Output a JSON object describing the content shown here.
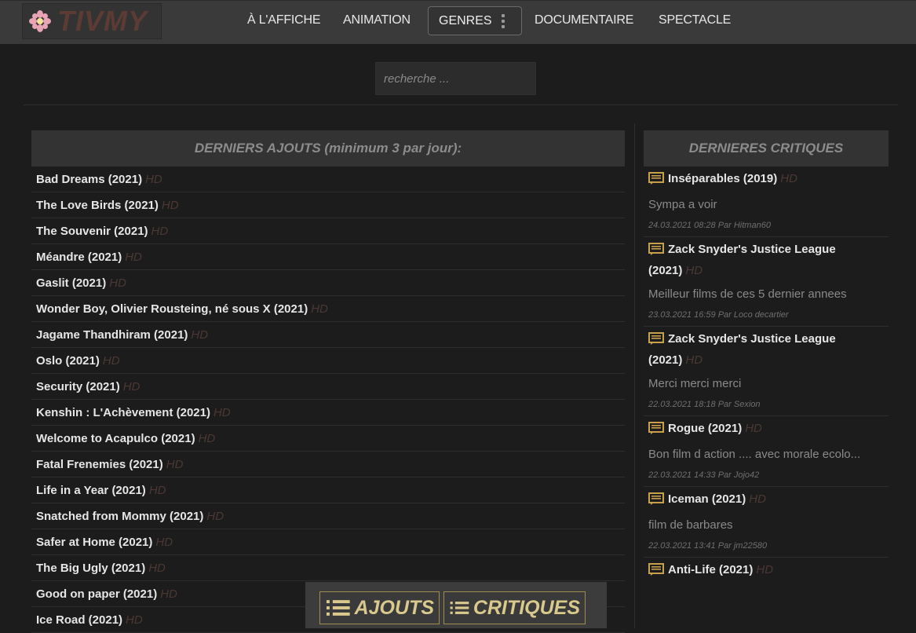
{
  "header": {
    "logo_text": "TIVMY",
    "nav": {
      "affiche": "À L'AFFICHE",
      "animation": "ANIMATION",
      "genres": "GENRES",
      "documentaire": "DOCUMENTAIRE",
      "spectacle": "SPECTACLE"
    }
  },
  "search": {
    "placeholder": "recherche ..."
  },
  "latest": {
    "title": "DERNIERS AJOUTS (minimum 3 par jour):",
    "badge": "HD",
    "items": [
      "Bad Dreams (2021)",
      "The Love Birds (2021)",
      "The Souvenir (2021)",
      "Méandre (2021)",
      "Gaslit (2021)",
      "Wonder Boy, Olivier Rousteing, né sous X (2021)",
      "Jagame Thandhiram (2021)",
      "Oslo (2021)",
      "Security (2021)",
      "Kenshin : L'Achèvement (2021)",
      "Welcome to Acapulco (2021)",
      "Fatal Frenemies (2021)",
      "Life in a Year (2021)",
      "Snatched from Mommy (2021)",
      "Safer at Home (2021)",
      "The Big Ugly (2021)",
      "Good on paper (2021)",
      "Ice Road (2021)"
    ]
  },
  "critiques": {
    "title": "DERNIERES CRITIQUES",
    "items": [
      {
        "film": "Inséparables (2019)",
        "badge": "HD",
        "text": "Sympa a voir",
        "meta": "24.03.2021 08:28 Par Hitman60"
      },
      {
        "film": "Zack Snyder's Justice League (2021)",
        "badge": "HD",
        "text": "Meilleur films de ces 5 dernier annees",
        "meta": "23.03.2021 16:59 Par Loco decartier"
      },
      {
        "film": "Zack Snyder's Justice League (2021)",
        "badge": "HD",
        "text": "Merci merci merci",
        "meta": "22.03.2021 18:18 Par Sexion"
      },
      {
        "film": "Rogue (2021)",
        "badge": "HD",
        "text": "Bon film d action .... avec morale ecolo...",
        "meta": "22.03.2021 14:33 Par Jojo42"
      },
      {
        "film": "Iceman (2021)",
        "badge": "HD",
        "text": "film de barbares",
        "meta": "22.03.2021 13:41 Par jm22580"
      },
      {
        "film": "Anti-Life (2021)",
        "badge": "HD",
        "text": "",
        "meta": ""
      }
    ]
  },
  "floatbar": {
    "ajouts": "AJOUTS",
    "critiques": "CRITIQUES"
  },
  "colors": {
    "background": "#1c1c1c",
    "topbar": "#3a3a3a",
    "accent": "#d9c98d",
    "hd_badge": "#4b3834"
  },
  "icons": [
    "flower-logo-icon",
    "kebab-menu-icon",
    "comment-icon",
    "list-icon"
  ]
}
